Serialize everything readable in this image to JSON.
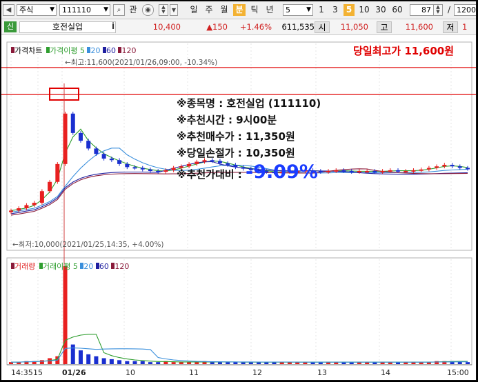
{
  "toolbar": {
    "market_select": "주식",
    "code_input": "111110",
    "search_icon": "magnifier-icon",
    "relation_label": "관",
    "periods": [
      "일",
      "주",
      "월",
      "분",
      "틱",
      "년"
    ],
    "active_period": "분",
    "interval_select": "5",
    "quick_intervals": [
      "1",
      "3",
      "5",
      "10",
      "30",
      "60"
    ],
    "active_interval": "5",
    "count_input": "87",
    "total_input": "1200"
  },
  "stock_bar": {
    "credit_badge": "신",
    "name": "호전실업",
    "info_mark": "i",
    "price": "10,400",
    "change": "▲150",
    "change_pct": "+1.46%",
    "volume": "611,535",
    "open_label": "시",
    "open": "11,050",
    "high_label": "고",
    "high": "11,600",
    "low_label": "저",
    "low": "1"
  },
  "price_panel": {
    "legend_title": "가격차트",
    "ma_label": "가격이평",
    "ma_periods": [
      "5",
      "20",
      "60",
      "120"
    ],
    "ma_colors": [
      "#2f9e2f",
      "#3a8fdc",
      "#1f1fa0",
      "#8a1a3a"
    ],
    "headline": "당일최고가 11,600원",
    "max_note": "←최고:11,600(2021/01/26,09:00, -10.34%)",
    "min_note": "←최저:10,000(2021/01/25,14:35, +4.00%)"
  },
  "info_box": {
    "line1": "※종목명 : 호전실업 (111110)",
    "line2": "※추천시간 : 9시00분",
    "line3": "※추천매수가 : 11,350원",
    "line4": "※당일손절가 : 10,350원",
    "line5_label": "※추천가대비 : ",
    "line5_value": "-9.09%"
  },
  "volume_panel": {
    "legend_title": "거래량",
    "ma_label": "거래이평",
    "ma_periods": [
      "5",
      "20",
      "60",
      "120"
    ]
  },
  "x_axis": {
    "labels": [
      "14:35",
      "15",
      "01/26",
      "10",
      "11",
      "12",
      "13",
      "14",
      "15:00"
    ]
  },
  "colors": {
    "up": "#e82020",
    "down": "#1a2fd0",
    "highlight": "#e00000",
    "value_blue": "#1a3cff"
  },
  "chart_data": {
    "type": "candlestick",
    "price_axis_note": "no numeric price axis visible",
    "high": 11600,
    "low": 10000,
    "candles_close_trend": [
      10050,
      10080,
      10120,
      10150,
      10300,
      10420,
      10650,
      11300,
      11050,
      10950,
      10850,
      10780,
      10720,
      10700,
      10650,
      10610,
      10600,
      10580,
      10560,
      10550,
      10570,
      10600,
      10620,
      10650,
      10680,
      10700,
      10690,
      10660,
      10640,
      10610,
      10590,
      10580,
      10560,
      10550,
      10540,
      10550,
      10560,
      10560,
      10570,
      10560,
      10550,
      10560,
      10570,
      10560,
      10550,
      10560,
      10560,
      10550,
      10560,
      10570,
      10560,
      10560,
      10570,
      10580,
      10600,
      10620,
      10640,
      10620,
      10600,
      10590
    ],
    "volume_trend": [
      2,
      2,
      3,
      3,
      4,
      6,
      8,
      100,
      20,
      14,
      10,
      8,
      6,
      5,
      4,
      3,
      3,
      3,
      2,
      2,
      3,
      2,
      2,
      2,
      2,
      3,
      2,
      2,
      2,
      2,
      2,
      2,
      2,
      2,
      2,
      2,
      2,
      2,
      2,
      2,
      2,
      2,
      2,
      2,
      2,
      2,
      2,
      2,
      2,
      2,
      2,
      2,
      2,
      2,
      2,
      3,
      3,
      3,
      3,
      2
    ]
  }
}
